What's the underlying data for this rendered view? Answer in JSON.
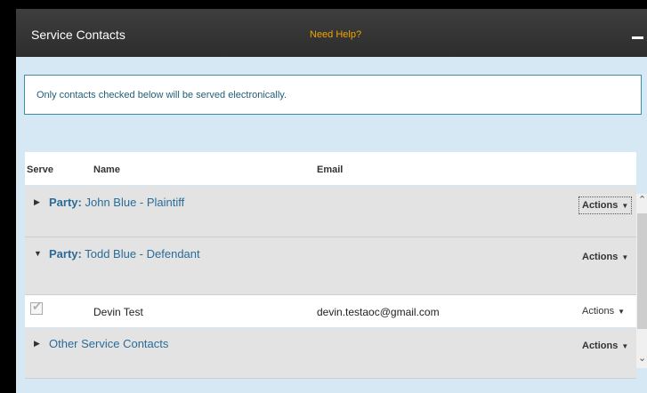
{
  "panel": {
    "title": "Service Contacts",
    "help_link": "Need Help?"
  },
  "notice": "Only contacts checked below will be served electronically.",
  "columns": {
    "serve": "Serve",
    "name": "Name",
    "email": "Email"
  },
  "groups": [
    {
      "prefix": "Party:",
      "name": "John Blue - Plaintiff",
      "expanded": false,
      "actions": "Actions"
    },
    {
      "prefix": "Party:",
      "name": "Todd Blue - Defendant",
      "expanded": true,
      "actions": "Actions"
    },
    {
      "prefix": "",
      "name": "Other Service Contacts",
      "expanded": false,
      "actions": "Actions"
    }
  ],
  "contacts": [
    {
      "name": "Devin Test",
      "email": "devin.testaoc@gmail.com",
      "actions": "Actions",
      "checked": true
    }
  ],
  "icons": {
    "expand": "caret-right-icon",
    "collapse": "caret-down-icon",
    "dropdown": "dropdown-caret-icon",
    "check": "checkmark-icon"
  },
  "colors": {
    "title_bar": "#333333",
    "help_link": "#f0a500",
    "group_label": "#2a6c99",
    "panel_bg": "#d5e8f4"
  }
}
